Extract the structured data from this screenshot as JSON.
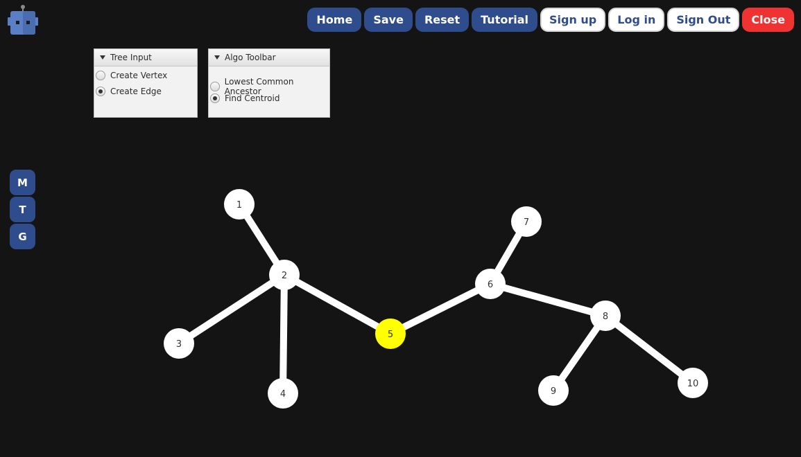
{
  "topnav": {
    "buttons": [
      {
        "label": "Home",
        "style": "primary"
      },
      {
        "label": "Save",
        "style": "primary"
      },
      {
        "label": "Reset",
        "style": "primary"
      },
      {
        "label": "Tutorial",
        "style": "primary"
      },
      {
        "label": "Sign up",
        "style": "light"
      },
      {
        "label": "Log in",
        "style": "light"
      },
      {
        "label": "Sign Out",
        "style": "light"
      },
      {
        "label": "Close",
        "style": "danger"
      }
    ]
  },
  "tree_input": {
    "title": "Tree Input",
    "options": [
      {
        "label": "Create Vertex",
        "checked": false
      },
      {
        "label": "Create Edge",
        "checked": true
      }
    ]
  },
  "algo_toolbar": {
    "title": "Algo Toolbar",
    "options": [
      {
        "label": "Lowest Common Ancestor",
        "checked": false
      },
      {
        "label": "Find Centroid",
        "checked": true
      }
    ]
  },
  "side_buttons": [
    "M",
    "T",
    "G"
  ],
  "graph": {
    "node_color": "#ffffff",
    "highlight_color": "#ffff00",
    "edge_color": "#ffffff",
    "nodes": [
      {
        "id": "1",
        "highlighted": false
      },
      {
        "id": "2",
        "highlighted": false
      },
      {
        "id": "3",
        "highlighted": false
      },
      {
        "id": "4",
        "highlighted": false
      },
      {
        "id": "5",
        "highlighted": true
      },
      {
        "id": "6",
        "highlighted": false
      },
      {
        "id": "7",
        "highlighted": false
      },
      {
        "id": "8",
        "highlighted": false
      },
      {
        "id": "9",
        "highlighted": false
      },
      {
        "id": "10",
        "highlighted": false
      }
    ],
    "edges": [
      [
        "1",
        "2"
      ],
      [
        "2",
        "3"
      ],
      [
        "2",
        "4"
      ],
      [
        "2",
        "5"
      ],
      [
        "5",
        "6"
      ],
      [
        "6",
        "7"
      ],
      [
        "6",
        "8"
      ],
      [
        "8",
        "9"
      ],
      [
        "8",
        "10"
      ]
    ]
  }
}
